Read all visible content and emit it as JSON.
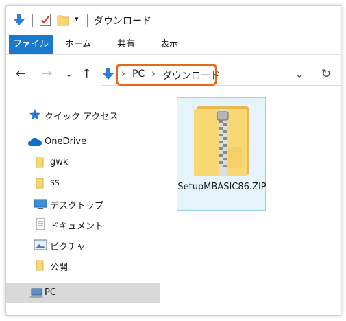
{
  "window": {
    "title": "ダウンロード",
    "colors": {
      "accent": "#1979ca",
      "highlight": "#e8681a",
      "selection": "#e5f3fb",
      "folder": "#f8d775"
    }
  },
  "ribbon": {
    "tabs": [
      {
        "label": "ファイル",
        "active": true
      },
      {
        "label": "ホーム"
      },
      {
        "label": "共有"
      },
      {
        "label": "表示"
      }
    ]
  },
  "nav": {
    "breadcrumbs": [
      "PC",
      "ダウンロード"
    ],
    "separator": "›"
  },
  "sidebar": {
    "items": [
      {
        "label": "クイック アクセス",
        "icon": "star-icon"
      },
      {
        "label": "OneDrive",
        "icon": "cloud-icon"
      },
      {
        "label": "gwk",
        "icon": "folder-icon"
      },
      {
        "label": "ss",
        "icon": "folder-icon"
      },
      {
        "label": "デスクトップ",
        "icon": "desktop-icon"
      },
      {
        "label": "ドキュメント",
        "icon": "document-icon"
      },
      {
        "label": "ピクチャ",
        "icon": "pictures-icon"
      },
      {
        "label": "公開",
        "icon": "folder-icon"
      },
      {
        "label": "PC",
        "icon": "pc-icon",
        "selected": true
      }
    ]
  },
  "content": {
    "files": [
      {
        "name": "SetupMBASIC86.ZIP",
        "icon": "zip-folder-icon",
        "selected": true
      }
    ]
  }
}
